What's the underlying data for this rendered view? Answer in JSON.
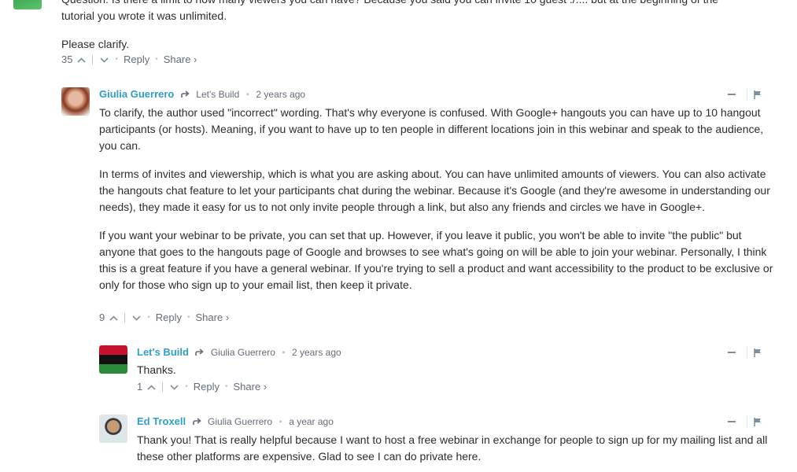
{
  "comment0": {
    "line1": "Question: Is there a limit to how many viewers you can have? Because you said you can invite 10 guest :/.... but at the beginning of the",
    "line2": "tutorial you wrote it was unlimited.",
    "line3": "Please clarify.",
    "votes": "35",
    "reply_label": "Reply",
    "share_label": "Share ›"
  },
  "comment1": {
    "author": "Giulia Guerrero",
    "reply_to": "Let's Build",
    "time": "2 years ago",
    "paragraphs": [
      "To clarify, the author used \"incorrect\" wording. That's why everyone is confused. With Google+ hangouts you can have up to 10 hangout participants (or hosts). Meaning, if you want to have up to ten people in different locations join in this webinar and speak to the audience, you can.",
      "In terms of invites and viewership, which is what you are asking about. You can have unlimited amounts of viewers. You can also activate the hangouts chat feature to let your participants chat during the webinar. Because it's Google (and they're awesome in understanding our needs), they made it easy for us to not only invite people through a link, but also any friends and circles we have in Google+.",
      "If you want your webinar to be private, you can set that up. However, if you leave it public, you won't be able to invite \"the public\" but anyone that goes to the hangouts page of Google and browses to see what's going on will be able to join your webinar. Personally, I think this is a great feature if you have a general webinar. If you're trying to sell a product and want accessibility to the product to be exclusive or only for those who sign up to your email list, then keep it private."
    ],
    "votes": "9",
    "reply_label": "Reply",
    "share_label": "Share ›"
  },
  "comment2": {
    "author": "Let's Build",
    "reply_to": "Giulia Guerrero",
    "time": "2 years ago",
    "paragraphs": [
      "Thanks."
    ],
    "votes": "1",
    "reply_label": "Reply",
    "share_label": "Share ›"
  },
  "comment3": {
    "author": "Ed Troxell",
    "reply_to": "Giulia Guerrero",
    "time": "a year ago",
    "paragraphs": [
      "Thank you! That is really helpful because I want to host a free webinar in exchange for people to sign up for my mailing list and all these other platforms are expensive. Glad to see I can do private here."
    ]
  },
  "colors": {
    "author_link": "#2e9fc9",
    "body_text": "#2a2e2e",
    "meta_text": "#656c7a"
  }
}
